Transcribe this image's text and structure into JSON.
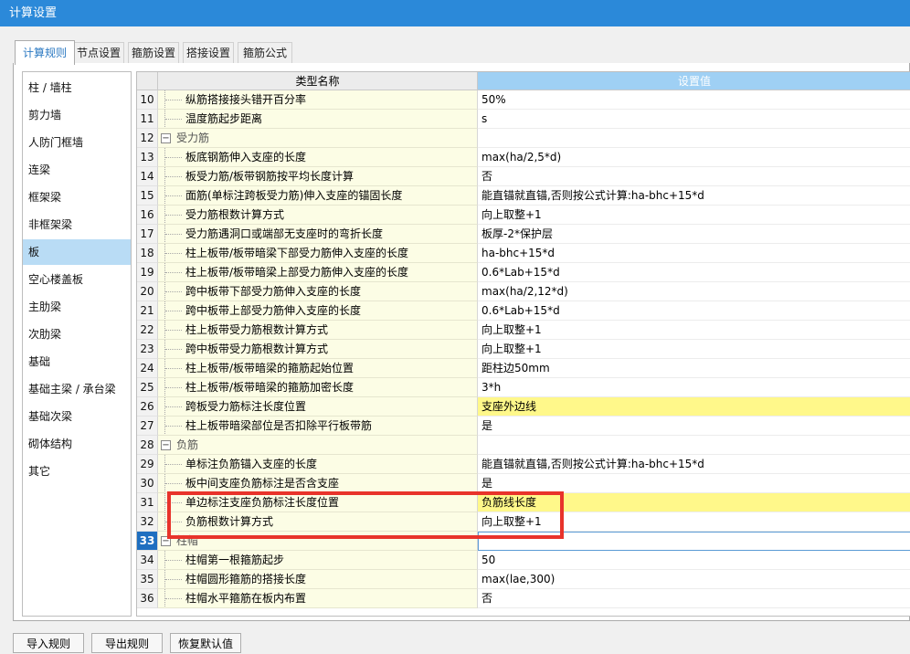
{
  "window": {
    "title": "计算设置"
  },
  "tabs": [
    {
      "label": "计算规则",
      "active": true
    },
    {
      "label": "节点设置",
      "active": false
    },
    {
      "label": "箍筋设置",
      "active": false
    },
    {
      "label": "搭接设置",
      "active": false
    },
    {
      "label": "箍筋公式",
      "active": false
    }
  ],
  "sidebar": {
    "selected": "板",
    "items": [
      "柱 / 墙柱",
      "剪力墙",
      "人防门框墙",
      "连梁",
      "框架梁",
      "非框架梁",
      "板",
      "空心楼盖板",
      "主肋梁",
      "次肋梁",
      "基础",
      "基础主梁 / 承台梁",
      "基础次梁",
      "砌体结构",
      "其它"
    ]
  },
  "grid": {
    "header_name": "类型名称",
    "header_value": "设置值",
    "current_row": "33",
    "rows": [
      {
        "num": "10",
        "name": "纵筋搭接接头错开百分率",
        "value": "50%"
      },
      {
        "num": "11",
        "name": "温度筋起步距离",
        "value": "s"
      },
      {
        "num": "12",
        "name": "受力筋",
        "value": "",
        "group": true
      },
      {
        "num": "13",
        "name": "板底钢筋伸入支座的长度",
        "value": "max(ha/2,5*d)"
      },
      {
        "num": "14",
        "name": "板受力筋/板带钢筋按平均长度计算",
        "value": "否"
      },
      {
        "num": "15",
        "name": "面筋(单标注跨板受力筋)伸入支座的锚固长度",
        "value": "能直锚就直锚,否则按公式计算:ha-bhc+15*d"
      },
      {
        "num": "16",
        "name": "受力筋根数计算方式",
        "value": "向上取整+1"
      },
      {
        "num": "17",
        "name": "受力筋遇洞口或端部无支座时的弯折长度",
        "value": "板厚-2*保护层"
      },
      {
        "num": "18",
        "name": "柱上板带/板带暗梁下部受力筋伸入支座的长度",
        "value": "ha-bhc+15*d"
      },
      {
        "num": "19",
        "name": "柱上板带/板带暗梁上部受力筋伸入支座的长度",
        "value": "0.6*Lab+15*d"
      },
      {
        "num": "20",
        "name": "跨中板带下部受力筋伸入支座的长度",
        "value": "max(ha/2,12*d)"
      },
      {
        "num": "21",
        "name": "跨中板带上部受力筋伸入支座的长度",
        "value": "0.6*Lab+15*d"
      },
      {
        "num": "22",
        "name": "柱上板带受力筋根数计算方式",
        "value": "向上取整+1"
      },
      {
        "num": "23",
        "name": "跨中板带受力筋根数计算方式",
        "value": "向上取整+1"
      },
      {
        "num": "24",
        "name": "柱上板带/板带暗梁的箍筋起始位置",
        "value": "距柱边50mm"
      },
      {
        "num": "25",
        "name": "柱上板带/板带暗梁的箍筋加密长度",
        "value": "3*h"
      },
      {
        "num": "26",
        "name": "跨板受力筋标注长度位置",
        "value": "支座外边线",
        "highlight": true
      },
      {
        "num": "27",
        "name": "柱上板带暗梁部位是否扣除平行板带筋",
        "value": "是"
      },
      {
        "num": "28",
        "name": "负筋",
        "value": "",
        "group": true
      },
      {
        "num": "29",
        "name": "单标注负筋锚入支座的长度",
        "value": "能直锚就直锚,否则按公式计算:ha-bhc+15*d"
      },
      {
        "num": "30",
        "name": "板中间支座负筋标注是否含支座",
        "value": "是"
      },
      {
        "num": "31",
        "name": "单边标注支座负筋标注长度位置",
        "value": "负筋线长度",
        "highlight": true
      },
      {
        "num": "32",
        "name": "负筋根数计算方式",
        "value": "向上取整+1"
      },
      {
        "num": "33",
        "name": "柱帽",
        "value": "",
        "group": true
      },
      {
        "num": "34",
        "name": "柱帽第一根箍筋起步",
        "value": "50"
      },
      {
        "num": "35",
        "name": "柱帽圆形箍筋的搭接长度",
        "value": "max(lae,300)"
      },
      {
        "num": "36",
        "name": "柱帽水平箍筋在板内布置",
        "value": "否"
      }
    ]
  },
  "footer": {
    "import_label": "导入规则",
    "export_label": "导出规则",
    "restore_label": "恢复默认值"
  },
  "colors": {
    "titlebar": "#2b89d9",
    "selected_sidebar": "#b9dcf5",
    "value_header": "#9fd0f4",
    "name_column": "#fcfde5",
    "highlight_value": "#fff88a",
    "annotation_box": "#e8332b"
  }
}
